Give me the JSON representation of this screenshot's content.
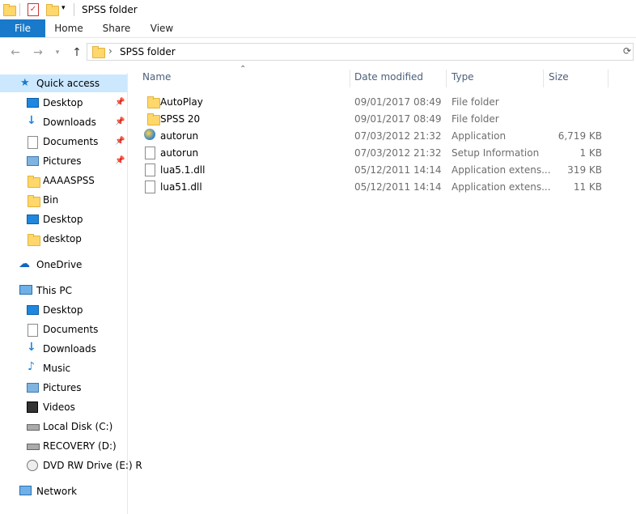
{
  "window": {
    "title": "SPSS folder"
  },
  "ribbon": {
    "tabs": [
      "File",
      "Home",
      "Share",
      "View"
    ]
  },
  "address": {
    "path_item": "SPSS folder"
  },
  "sidebar": {
    "quick_access": "Quick access",
    "quick_items": [
      "Desktop",
      "Downloads",
      "Documents",
      "Pictures",
      "AAAASPSS",
      "Bin",
      "Desktop",
      "desktop"
    ],
    "onedrive": "OneDrive",
    "this_pc": "This PC",
    "pc_items": [
      "Desktop",
      "Documents",
      "Downloads",
      "Music",
      "Pictures",
      "Videos",
      "Local Disk (C:)",
      "RECOVERY (D:)",
      "DVD RW Drive (E:) R"
    ],
    "network": "Network"
  },
  "columns": {
    "name": "Name",
    "date": "Date modified",
    "type": "Type",
    "size": "Size"
  },
  "files": [
    {
      "name": "AutoPlay",
      "date": "09/01/2017 08:49",
      "type": "File folder",
      "size": ""
    },
    {
      "name": "SPSS 20",
      "date": "09/01/2017 08:49",
      "type": "File folder",
      "size": ""
    },
    {
      "name": "autorun",
      "date": "07/03/2012 21:32",
      "type": "Application",
      "size": "6,719 KB"
    },
    {
      "name": "autorun",
      "date": "07/03/2012 21:32",
      "type": "Setup Information",
      "size": "1 KB"
    },
    {
      "name": "lua5.1.dll",
      "date": "05/12/2011 14:14",
      "type": "Application extens...",
      "size": "319 KB"
    },
    {
      "name": "lua51.dll",
      "date": "05/12/2011 14:14",
      "type": "Application extens...",
      "size": "11 KB"
    }
  ]
}
